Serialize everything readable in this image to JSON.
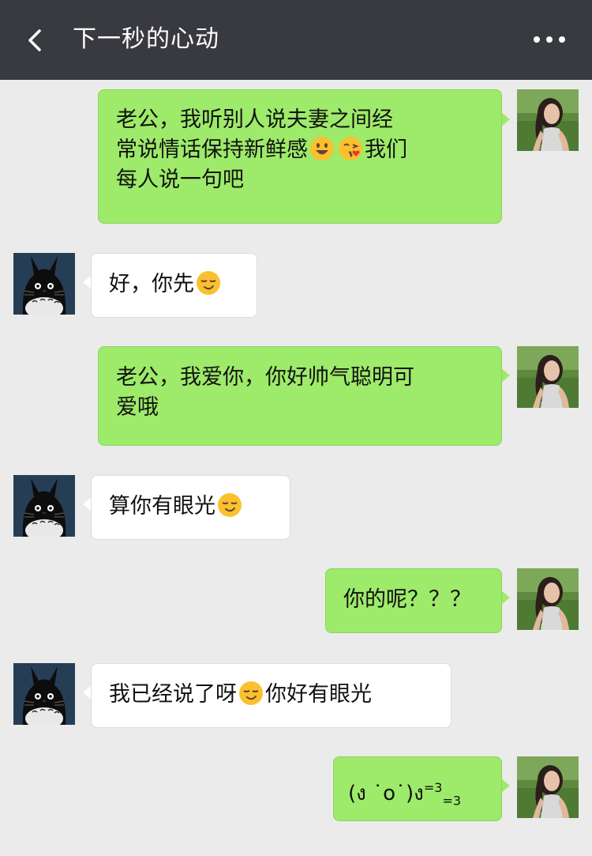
{
  "header": {
    "title": "下一秒的心动",
    "back_icon": "chevron-left-icon",
    "more_icon": "more-dots-icon",
    "background": "#393a3f"
  },
  "colors": {
    "chat_background": "#ebebeb",
    "my_bubble": "#9eea6a",
    "other_bubble": "#ffffff"
  },
  "messages": [
    {
      "sender": "me",
      "line1": "老公，我听别人说夫妻之间经",
      "line2a": "常说情话保持新鲜感",
      "emoji1": "smiling-face-icon",
      "emoji2": "kissing-face-icon",
      "line2b": "我们",
      "line3": "每人说一句吧"
    },
    {
      "sender": "other",
      "text": "好，你先",
      "emoji": "smirk-face-icon"
    },
    {
      "sender": "me",
      "line1": "老公，我爱你，你好帅气聪明可",
      "line2": "爱哦"
    },
    {
      "sender": "other",
      "text": "算你有眼光",
      "emoji": "smirk-face-icon"
    },
    {
      "sender": "me",
      "text": "你的呢？？？"
    },
    {
      "sender": "other",
      "text_a": "我已经说了呀",
      "emoji": "smirk-face-icon",
      "text_b": "你好有眼光"
    },
    {
      "sender": "me",
      "text_main": "(ง ˙o˙)ง",
      "text_sup": "=3",
      "text_sub": "=3"
    }
  ]
}
